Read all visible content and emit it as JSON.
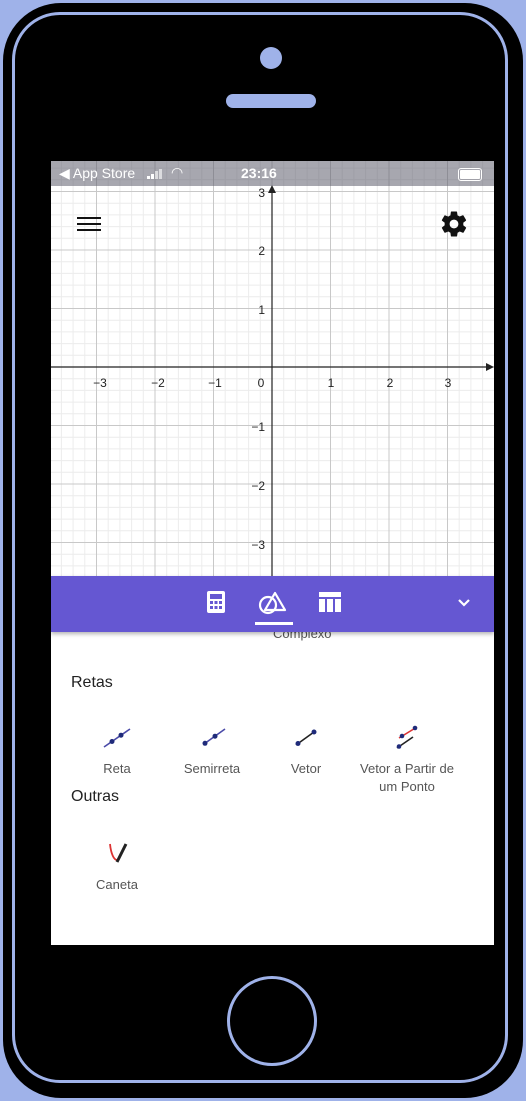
{
  "status_bar": {
    "back_label": "◀ App Store",
    "time": "23:16"
  },
  "graph": {
    "x_ticks": [
      "−3",
      "−2",
      "−1",
      "0",
      "1",
      "2",
      "3"
    ],
    "y_ticks": [
      "3",
      "2",
      "1",
      "−1",
      "−2",
      "−3"
    ]
  },
  "toolbar": {
    "tabs": [
      {
        "name": "calculator",
        "active": false
      },
      {
        "name": "tools",
        "active": true
      },
      {
        "name": "table",
        "active": false
      }
    ],
    "accent_color": "#6557d2"
  },
  "tools_panel": {
    "partial_label": "Complexo",
    "sections": [
      {
        "title": "Retas",
        "tools": [
          {
            "label": "Reta",
            "icon": "line-icon"
          },
          {
            "label": "Semirreta",
            "icon": "ray-icon"
          },
          {
            "label": "Vetor",
            "icon": "vector-icon"
          },
          {
            "label": "Vetor a Partir de um Ponto",
            "icon": "vector-from-point-icon"
          }
        ]
      },
      {
        "title": "Outras",
        "tools": [
          {
            "label": "Caneta",
            "icon": "pen-icon"
          }
        ]
      }
    ]
  },
  "colors": {
    "frame_background": "#9fb2e9",
    "phone_body": "#000000",
    "screen": "#ffffff"
  }
}
